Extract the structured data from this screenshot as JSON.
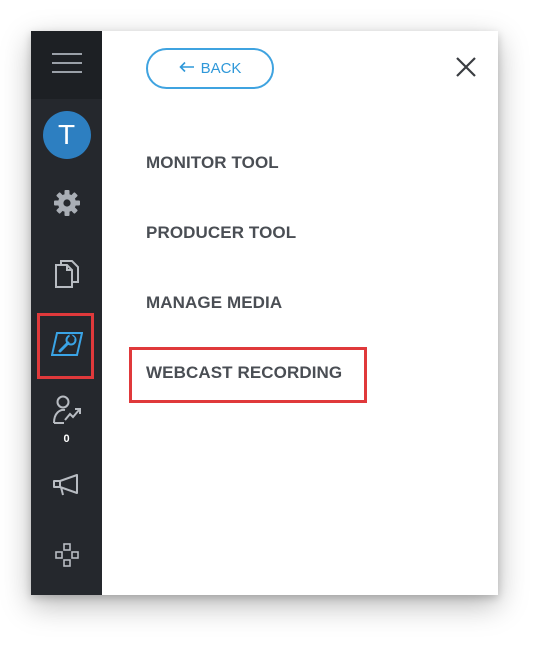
{
  "sidebar": {
    "menu_icon": "hamburger-icon",
    "avatar_letter": "T",
    "avatar_color": "#2d7fc1",
    "items": [
      {
        "icon": "gear-icon"
      },
      {
        "icon": "documents-icon"
      },
      {
        "icon": "tools-icon",
        "highlighted": true
      },
      {
        "icon": "user-chart-icon",
        "badge": "0"
      },
      {
        "icon": "megaphone-icon"
      },
      {
        "icon": "network-icon"
      }
    ]
  },
  "panel": {
    "back_label": "BACK",
    "back_icon": "arrow-left-icon",
    "close_icon": "close-icon",
    "menu_items": [
      {
        "label": "MONITOR TOOL"
      },
      {
        "label": "PRODUCER TOOL"
      },
      {
        "label": "MANAGE MEDIA"
      },
      {
        "label": "WEBCAST RECORDING",
        "highlighted": true
      }
    ]
  },
  "colors": {
    "sidebar_bg": "#25282d",
    "accent": "#2f98d9",
    "highlight": "#e0393b",
    "menu_text": "#4a4e54"
  }
}
